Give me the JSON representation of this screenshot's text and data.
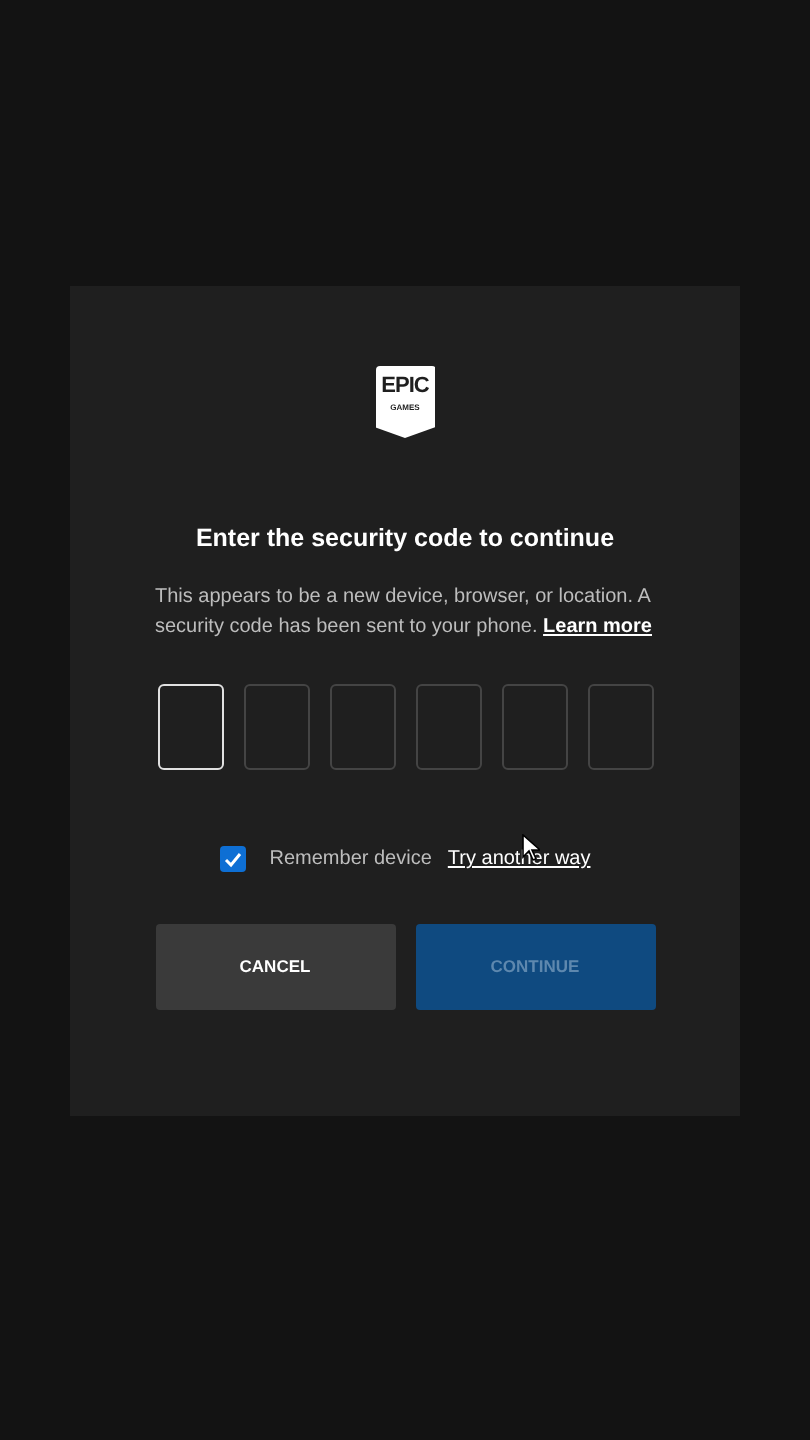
{
  "logo": {
    "line_1": "EPIC",
    "line_2": "GAMES"
  },
  "title": "Enter the security code to continue",
  "description": "This appears to be a new device, browser, or location. A security code has been sent to your phone.",
  "learn_more_link": "Learn more",
  "code_boxes": [
    {
      "selected": true
    },
    {
      "selected": false
    },
    {
      "selected": false
    },
    {
      "selected": false
    },
    {
      "selected": false
    },
    {
      "selected": false
    }
  ],
  "remember_device": {
    "label": "Remember device",
    "checked": true
  },
  "try_another_way_link": "Try another way",
  "buttons": [
    {
      "label": "CANCEL",
      "kind": "secondary",
      "disabled": false
    },
    {
      "label": "CONTINUE",
      "kind": "primary",
      "disabled": true
    }
  ]
}
